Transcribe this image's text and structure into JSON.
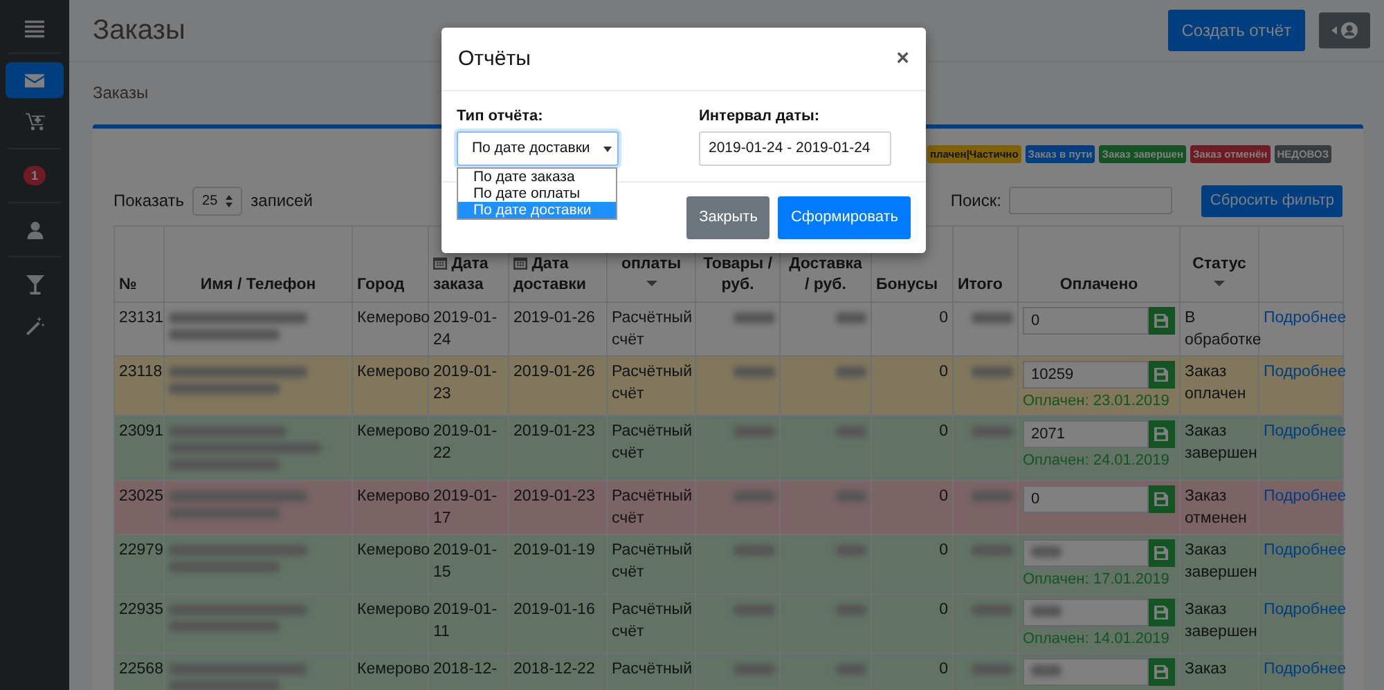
{
  "sidebar": {
    "items": [
      {
        "kind": "icon",
        "selected": true
      },
      {
        "kind": "icon",
        "selected": false
      },
      {
        "kind": "badge",
        "badge": "1",
        "selected": false
      },
      {
        "kind": "icon",
        "selected": false
      },
      {
        "kind": "icon",
        "selected": false
      },
      {
        "kind": "icon",
        "selected": false
      }
    ]
  },
  "header": {
    "title": "Заказы",
    "report_button": "Создать отчёт"
  },
  "breadcrumb": "Заказы",
  "legend": [
    {
      "label": "плачен|Частично",
      "color": "#806104"
    },
    {
      "label": "Заказ в пути",
      "color": "#003e80"
    },
    {
      "label": "Заказ завершен",
      "color": "#145323"
    },
    {
      "label": "Заказ отменён",
      "color": "#6e1b23"
    },
    {
      "label": "НЕДОВОЗ",
      "color": "#363b3f"
    }
  ],
  "length": {
    "prefix": "Показать",
    "value": "25",
    "suffix": "записей"
  },
  "search": {
    "label": "Поиск:"
  },
  "reset_button": "Сбросить фильтр",
  "table": {
    "columns": [
      {
        "label": "№",
        "kind": "text"
      },
      {
        "label": "Имя / Телефон",
        "kind": "text"
      },
      {
        "label": "Город",
        "kind": "text"
      },
      {
        "label": "Дата заказа",
        "kind": "date"
      },
      {
        "label": "Дата доставки",
        "kind": "date"
      },
      {
        "label": "оплаты",
        "kind": "filter"
      },
      {
        "label": "Товары / руб.",
        "kind": "text"
      },
      {
        "label": "Доставка / руб.",
        "kind": "text"
      },
      {
        "label": "Бонусы",
        "kind": "text"
      },
      {
        "label": "Итого",
        "kind": "text"
      },
      {
        "label": "Оплачено",
        "kind": "text"
      },
      {
        "label": "Статус",
        "kind": "filter"
      }
    ],
    "rows": [
      {
        "number": "23131",
        "city": "Кемерово",
        "order_date": "2019-01-24",
        "delivery_date": "2019-01-26",
        "payment": "Расчётный счёт",
        "bonus": "0",
        "paid": "0",
        "status": "В обработке",
        "details": "Подробнее",
        "color": "#808080"
      },
      {
        "number": "23118",
        "city": "Кемерово",
        "order_date": "2019-01-23",
        "delivery_date": "2019-01-26",
        "payment": "Расчётный счёт",
        "bonus": "0",
        "paid": "10259",
        "paid_note": "Оплачен: 23.01.2019",
        "status": "Заказ оплачен",
        "details": "Подробнее",
        "color": "#80775d"
      },
      {
        "number": "23091",
        "city": "Кемерово",
        "order_date": "2019-01-22",
        "delivery_date": "2019-01-23",
        "payment": "Расчётный счёт",
        "bonus": "0",
        "paid": "2071",
        "paid_note": "Оплачен: 24.01.2019",
        "status": "Заказ завершен",
        "details": "Подробнее",
        "color": "#627366"
      },
      {
        "number": "23025",
        "city": "Кемерово",
        "order_date": "2019-01-17",
        "delivery_date": "2019-01-23",
        "payment": "Расчётный счёт",
        "bonus": "0",
        "paid": "0",
        "status": "Заказ отменен",
        "details": "Подробнее",
        "color": "#7b6366"
      },
      {
        "number": "22979",
        "city": "Кемерово",
        "order_date": "2019-01-15",
        "delivery_date": "2019-01-19",
        "payment": "Расчётный счёт",
        "bonus": "0",
        "paid_note": "Оплачен: 17.01.2019",
        "status": "Заказ завершен",
        "details": "Подробнее",
        "color": "#627366"
      },
      {
        "number": "22935",
        "city": "Кемерово",
        "order_date": "2019-01-11",
        "delivery_date": "2019-01-16",
        "payment": "Расчётный счёт",
        "bonus": "0",
        "paid_note": "Оплачен: 14.01.2019",
        "status": "Заказ завершен",
        "details": "Подробнее",
        "color": "#627366"
      },
      {
        "number": "22568",
        "city": "Кемерово",
        "order_date": "2018-12-",
        "delivery_date": "2018-12-22",
        "payment": "Расчётный",
        "bonus": "0",
        "status": "Заказ",
        "details": "Подробнее",
        "color": "#627366"
      }
    ]
  },
  "modal": {
    "title": "Отчёты",
    "close": "×",
    "type_label": "Тип отчёта:",
    "type_value": "По дате доставки",
    "options": [
      {
        "label": "По дате заказа",
        "selected": false
      },
      {
        "label": "По дате оплаты",
        "selected": false
      },
      {
        "label": "По дате доставки",
        "selected": true
      }
    ],
    "interval_label": "Интервал даты:",
    "interval_value": "2019-01-24 - 2019-01-24",
    "buttons": [
      {
        "label": "Закрыть",
        "kind": "secondary"
      },
      {
        "label": "Сформировать",
        "kind": "primary"
      }
    ]
  }
}
